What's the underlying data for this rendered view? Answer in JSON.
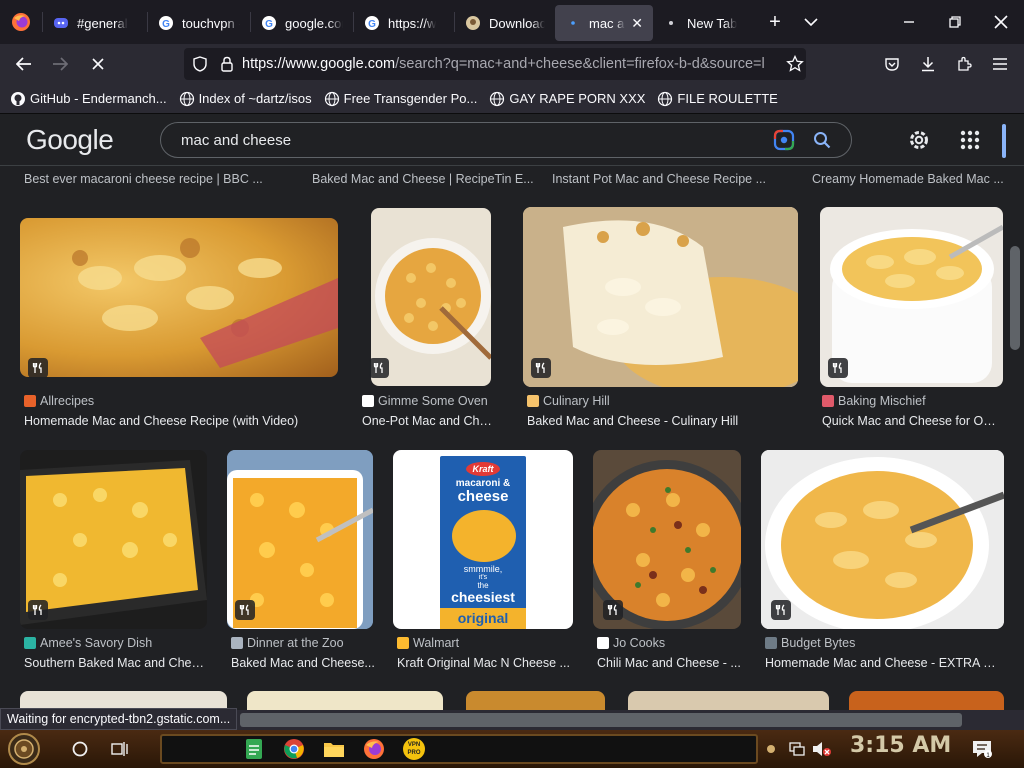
{
  "tabs": [
    {
      "label": "#general",
      "icon": "discord-icon"
    },
    {
      "label": "touchvpn -",
      "icon": "google-icon"
    },
    {
      "label": "google.com",
      "icon": "google-icon"
    },
    {
      "label": "https://w",
      "icon": "google-icon"
    },
    {
      "label": "Download",
      "icon": "download-site-icon"
    },
    {
      "label": "mac and",
      "icon": "loading-icon",
      "active": true
    },
    {
      "label": "New Tab",
      "icon": "dot-icon"
    }
  ],
  "nav": {
    "url_host": "https://www.google.com",
    "url_path": "/search?q=mac+and+cheese&client=firefox-b-d&source=l"
  },
  "bookmarks": [
    {
      "label": "GitHub - Endermanch...",
      "icon": "github-icon"
    },
    {
      "label": "Index of ~dartz/isos",
      "icon": "globe-icon"
    },
    {
      "label": "Free Transgender Po...",
      "icon": "globe-icon"
    },
    {
      "label": "GAY RAPE PORN XXX",
      "icon": "globe-icon"
    },
    {
      "label": "FILE ROULETTE",
      "icon": "globe-icon"
    }
  ],
  "google": {
    "logo": "Google",
    "query": "mac and cheese"
  },
  "top_captions": [
    "Best ever macaroni cheese recipe | BBC ...",
    "Baked Mac and Cheese | RecipeTin E...",
    "Instant Pot Mac and Cheese Recipe ...",
    "Creamy Homemade Baked Mac ..."
  ],
  "row1": [
    {
      "source": "Allrecipes",
      "title": "Homemade Mac and Cheese Recipe (with Video)",
      "src_color": "#e8622a"
    },
    {
      "source": "Gimme Some Oven",
      "title": "One-Pot Mac and Chee...",
      "src_color": "#ffffff"
    },
    {
      "source": "Culinary Hill",
      "title": "Baked Mac and Cheese - Culinary Hill",
      "src_color": "#f5c26b"
    },
    {
      "source": "Baking Mischief",
      "title": "Quick Mac and Cheese for One...",
      "src_color": "#e05a6a"
    }
  ],
  "row2": [
    {
      "source": "Amee's Savory Dish",
      "title": "Southern Baked Mac and Chee...",
      "src_color": "#2bb3a3"
    },
    {
      "source": "Dinner at the Zoo",
      "title": "Baked Mac and Cheese...",
      "src_color": "#aab4c0"
    },
    {
      "source": "Walmart",
      "title": "Kraft Original Mac N Cheese ...",
      "src_color": "#fdbb30"
    },
    {
      "source": "Jo Cooks",
      "title": "Chili Mac and Cheese - ...",
      "src_color": "#ffffff"
    },
    {
      "source": "Budget Bytes",
      "title": "Homemade Mac and Cheese - EXTRA ch...",
      "src_color": "#6e7b86"
    }
  ],
  "kraft": {
    "brand": "Kraft",
    "line1": "macaroni &",
    "line2": "cheese",
    "slogan1": "smmmile,",
    "slogan2": "it's",
    "slogan3": "the",
    "slogan4": "cheesiest",
    "variant": "original"
  },
  "status_text": "Waiting for encrypted-tbn2.gstatic.com...",
  "taskbar": {
    "clock": "3:15 AM",
    "vpn_label": "VPN PRO"
  }
}
